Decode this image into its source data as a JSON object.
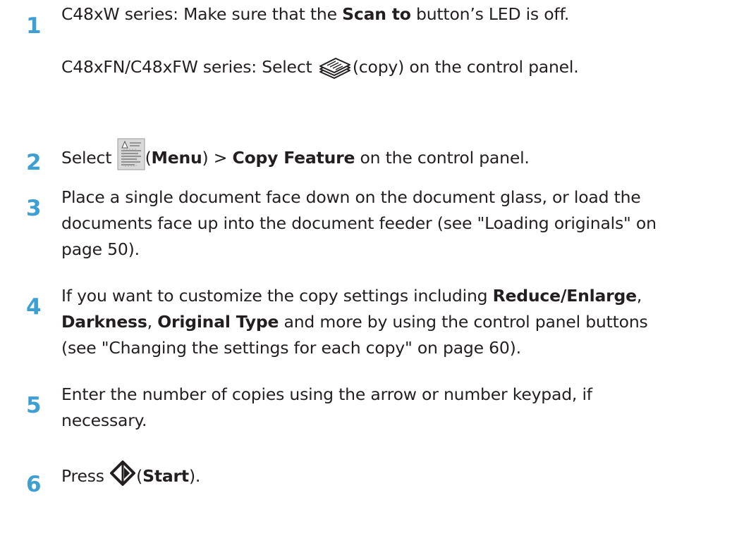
{
  "steps": [
    {
      "number": "1",
      "p1": {
        "a": "C48xW series: Make sure that the ",
        "b": "Scan to",
        "c": " button’s LED is off."
      },
      "p2": {
        "a": "C48xFN/C48xFW series: Select ",
        "icon": "copy-icon",
        "b": "(copy) on the control panel."
      }
    },
    {
      "number": "2",
      "a": "Select ",
      "icon": "menu-icon",
      "b": "(",
      "c": "Menu",
      "d": ") > ",
      "e": "Copy Feature",
      "f": " on the control panel."
    },
    {
      "number": "3",
      "lines": [
        "Place a single document face down on the document glass, or load the",
        "documents face up into the document feeder (see \"Loading originals\" on",
        "page 50)."
      ]
    },
    {
      "number": "4",
      "a": "If you want to customize the copy settings including ",
      "b": "Reduce/Enlarge",
      "c": ",",
      "d": "Darkness",
      "e": ", ",
      "f": "Original Type",
      "g": " and more by using the control panel buttons",
      "h": "(see \"Changing the settings for each copy\" on page 60)."
    },
    {
      "number": "5",
      "lines": [
        "Enter the number of copies using the arrow or number keypad, if",
        "necessary."
      ]
    },
    {
      "number": "6",
      "a": "Press ",
      "icon": "start-icon",
      "b": "(",
      "c": "Start",
      "d": ")."
    }
  ],
  "colors": {
    "step_number": "#3e9fd3",
    "text": "#231f20"
  }
}
